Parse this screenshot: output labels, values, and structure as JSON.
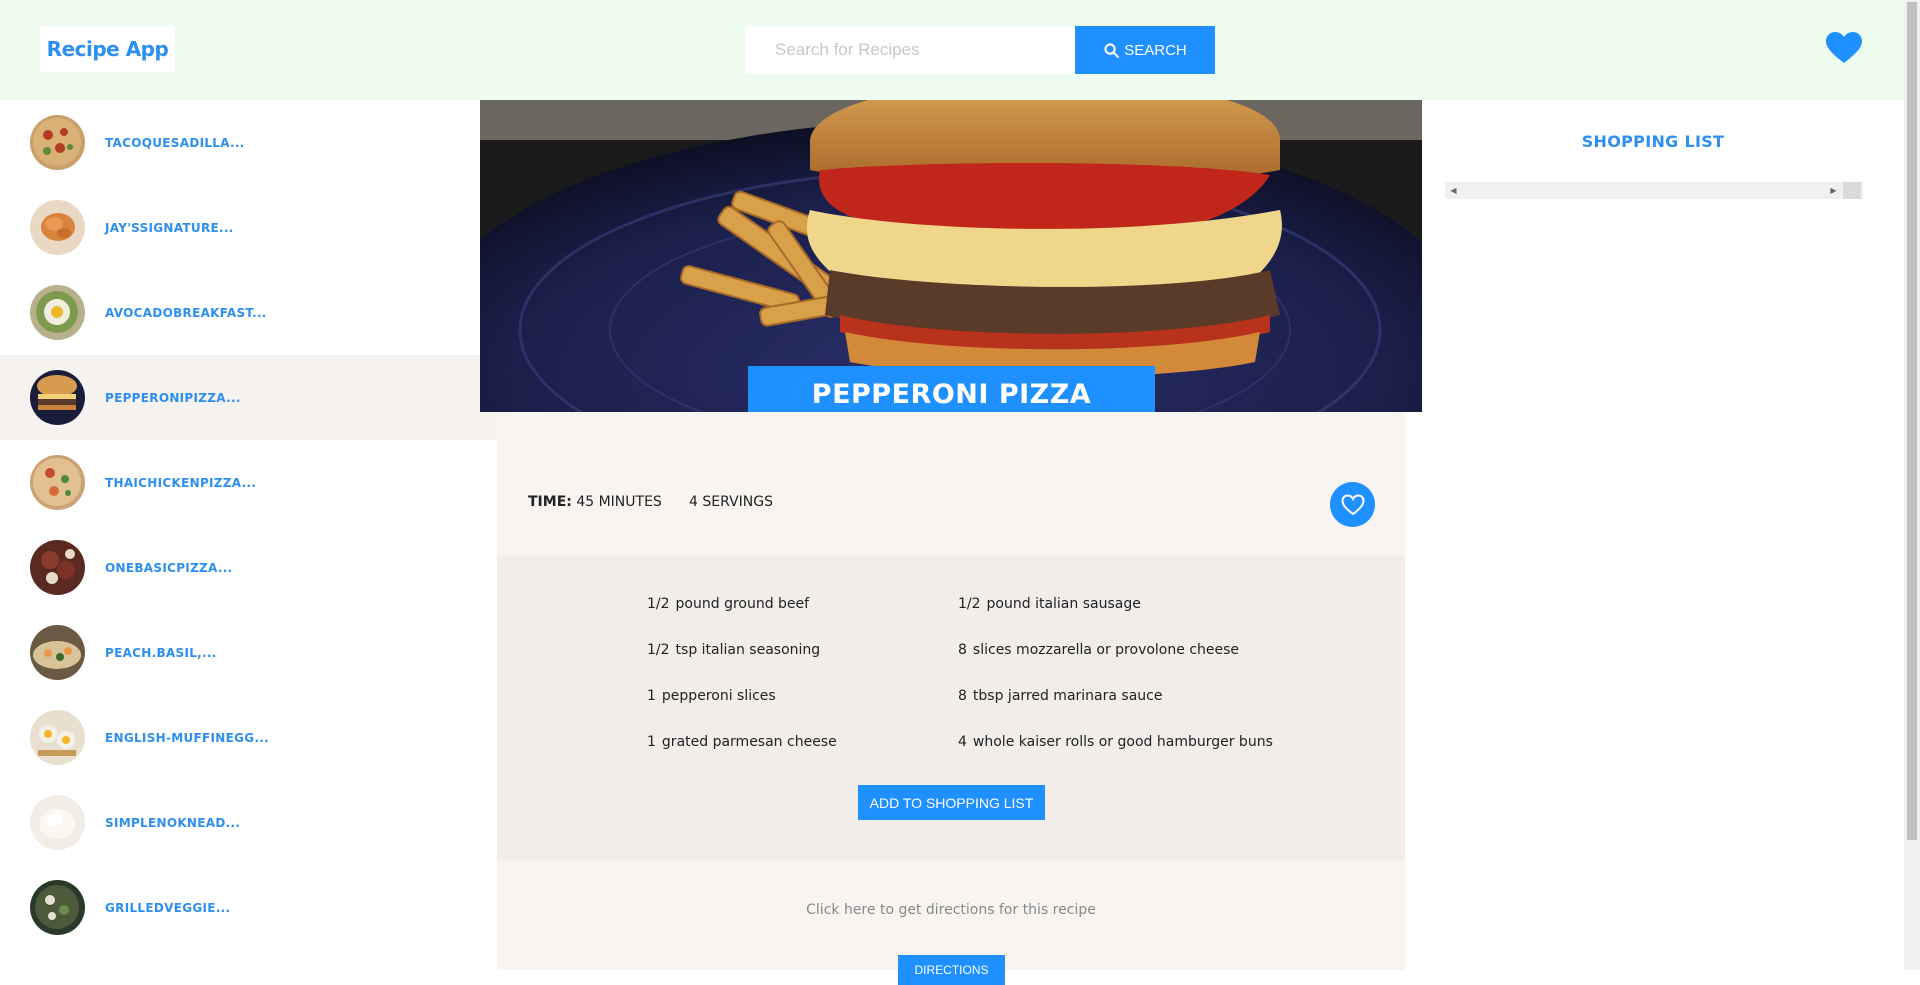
{
  "header": {
    "logo": "Recipe App",
    "search_placeholder": "Search for Recipes",
    "search_value": "",
    "search_label": "SEARCH",
    "favorites_icon": "heart-icon"
  },
  "sidebar": {
    "items": [
      {
        "label": "TACOQUESADILLA...",
        "thumb": "pizza"
      },
      {
        "label": "JAY'SSIGNATURE...",
        "thumb": "shrimp"
      },
      {
        "label": "AVOCADOBREAKFAST...",
        "thumb": "avocado-egg"
      },
      {
        "label": "PEPPERONIPIZZA...",
        "thumb": "burger",
        "active": true
      },
      {
        "label": "THAICHICKENPIZZA...",
        "thumb": "pizza"
      },
      {
        "label": "ONEBASICPIZZA...",
        "thumb": "meat-pizza"
      },
      {
        "label": "PEACH.BASIL,...",
        "thumb": "flatbread"
      },
      {
        "label": "ENGLISH-MUFFINEGG...",
        "thumb": "muffin-egg"
      },
      {
        "label": "SIMPLENOKNEAD...",
        "thumb": "dough"
      },
      {
        "label": "GRILLEDVEGGIE...",
        "thumb": "veggie-pizza"
      }
    ]
  },
  "recipe": {
    "title": "PEPPERONI PIZZA BURGERS",
    "time_label": "TIME:",
    "time_value": "45",
    "time_unit": "MINUTES",
    "servings_value": "4",
    "servings_unit": "SERVINGS",
    "favorite_icon": "heart-outline-icon",
    "ingredients": [
      {
        "qty": "1/2",
        "text": "pound ground beef"
      },
      {
        "qty": "1/2",
        "text": "pound italian sausage"
      },
      {
        "qty": "1/2",
        "text": "tsp italian seasoning"
      },
      {
        "qty": "8",
        "text": "slices mozzarella or provolone cheese"
      },
      {
        "qty": "1",
        "text": "pepperoni slices"
      },
      {
        "qty": "8",
        "text": "tbsp jarred marinara sauce"
      },
      {
        "qty": "1",
        "text": "grated parmesan cheese"
      },
      {
        "qty": "4",
        "text": "whole kaiser rolls or good hamburger buns"
      }
    ],
    "add_button": "ADD TO SHOPPING LIST",
    "directions_text": "Click here to get directions for this recipe",
    "directions_button": "DIRECTIONS"
  },
  "shopping_list": {
    "title": "SHOPPING LIST"
  },
  "colors": {
    "accent": "#1e90ff",
    "header_bg": "#eefcef",
    "link_blue": "#2d8ff0"
  }
}
